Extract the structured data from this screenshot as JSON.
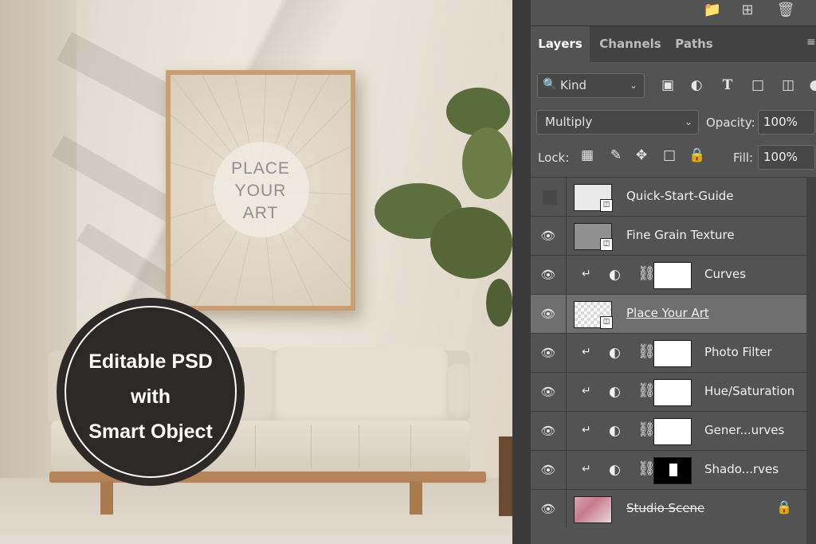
{
  "mockup": {
    "art_placeholder": [
      "PLACE",
      "YOUR",
      "ART"
    ],
    "badge_lines": [
      "Editable PSD",
      "with",
      "Smart Object"
    ]
  },
  "panel": {
    "top_icons": [
      "folder-icon",
      "new-layer-icon",
      "trash-icon"
    ],
    "tabs": [
      {
        "label": "Layers",
        "active": true
      },
      {
        "label": "Channels",
        "active": false
      },
      {
        "label": "Paths",
        "active": false
      }
    ],
    "filter": {
      "kind_label": "Kind"
    },
    "blend_mode": "Multiply",
    "opacity_label": "Opacity:",
    "opacity_value": "100%",
    "lock_label": "Lock:",
    "fill_label": "Fill:",
    "fill_value": "100%",
    "layers": [
      {
        "name": "Quick-Start-Guide",
        "visible": false
      },
      {
        "name": "Fine Grain Texture",
        "visible": true
      },
      {
        "name": "Curves",
        "visible": true
      },
      {
        "name": "Place Your Art",
        "visible": true,
        "selected": true
      },
      {
        "name": "Photo Filter",
        "visible": true
      },
      {
        "name": "Hue/Saturation",
        "visible": true
      },
      {
        "name": "Gener...urves",
        "visible": true
      },
      {
        "name": "Shado...rves",
        "visible": true
      },
      {
        "name": "Studio Scene",
        "visible": true,
        "locked": true
      }
    ]
  }
}
